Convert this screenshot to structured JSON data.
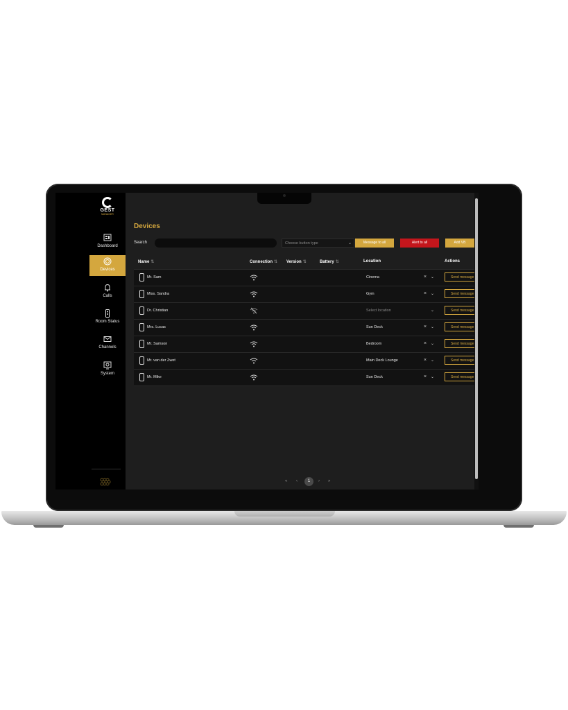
{
  "app": {
    "logo_text": "GEST",
    "logo_sub": "MANAGER",
    "accent_color": "#d4a73e",
    "alert_color": "#c4161c"
  },
  "sidebar": {
    "items": [
      {
        "label": "Dashboard",
        "icon": "dashboard-icon"
      },
      {
        "label": "Devices",
        "icon": "devices-icon"
      },
      {
        "label": "Calls",
        "icon": "bell-icon"
      },
      {
        "label": "Room Status",
        "icon": "room-status-icon"
      },
      {
        "label": "Channels",
        "icon": "mail-icon"
      },
      {
        "label": "System",
        "icon": "system-icon"
      }
    ],
    "active": "Devices"
  },
  "main": {
    "title": "Devices",
    "search_label": "Search",
    "select_placeholder": "Choose button type",
    "buttons": {
      "message_all": "Message to all",
      "alert_all": "Alert to all",
      "add": "Add VB"
    }
  },
  "table": {
    "headers": [
      "Name",
      "Connection",
      "Version",
      "Battery",
      "Location",
      "Actions"
    ],
    "rows": [
      {
        "name": "Mr. Sam",
        "connected": true,
        "location": "Cinema",
        "action": "Send message"
      },
      {
        "name": "Miss. Sandra",
        "connected": true,
        "location": "Gym",
        "action": "Send message"
      },
      {
        "name": "Dr. Christian",
        "connected": false,
        "location": "Select location",
        "action": "Send message"
      },
      {
        "name": "Mrs. Lucas",
        "connected": true,
        "location": "Sun Deck",
        "action": "Send message"
      },
      {
        "name": "Mr. Samson",
        "connected": true,
        "location": "Bedroom",
        "action": "Send message"
      },
      {
        "name": "Mr. van der Zwet",
        "connected": true,
        "location": "Main Deck Lounge",
        "action": "Send message"
      },
      {
        "name": "Mr. Mike",
        "connected": true,
        "location": "Sun Deck",
        "action": "Send message"
      }
    ]
  },
  "pagination": {
    "first": "«",
    "prev": "‹",
    "current": "1",
    "next": "›",
    "last": "»"
  }
}
